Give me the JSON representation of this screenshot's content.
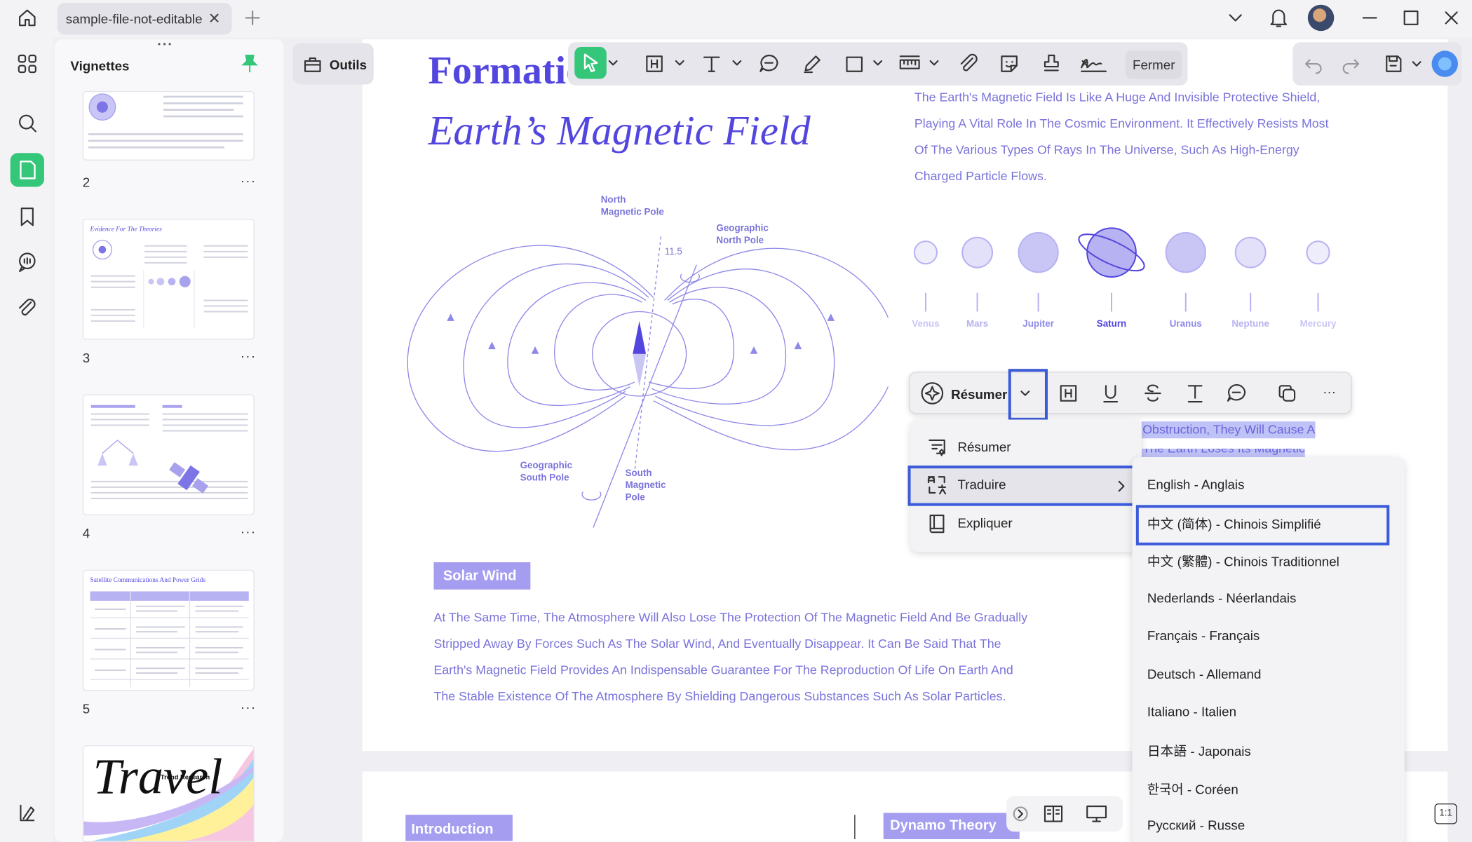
{
  "tab": {
    "title": "sample-file-not-editable",
    "close": "✕"
  },
  "sidebar": {
    "title": "Vignettes",
    "drag_dots": "• • •",
    "pages": [
      "2",
      "3",
      "4",
      "5"
    ],
    "page_more": "···"
  },
  "thumbnails": {
    "page3_title": "Evidence For The Theories",
    "page5_title": "Satellite Communications And Power Grids",
    "page6_text": "Travel",
    "page6_sub": "Trend Research"
  },
  "toolbar": {
    "outils": "Outils",
    "fermer": "Fermer"
  },
  "document": {
    "title_line1": "Formation Of The",
    "title_line2": "Earth’s Magnetic Field",
    "intro_lines": [
      "The Earth's Magnetic Field Is Like A Huge And Invisible Protective Shield,",
      "Playing A Vital Role In The Cosmic Environment. It Effectively Resists Most",
      "Of The Various Types Of Rays In The Universe, Such As High-Energy",
      "Charged Particle Flows."
    ],
    "diagram_labels": {
      "north_magnetic": [
        "North",
        "Magnetic Pole"
      ],
      "geo_north": [
        "Geographic",
        "North Pole"
      ],
      "angle": "11.5",
      "geo_south": [
        "Geographic",
        "South Pole"
      ],
      "south_magnetic": [
        "South",
        "Magnetic",
        "Pole"
      ]
    },
    "planets": [
      "Venus",
      "Mars",
      "Jupiter",
      "Saturn",
      "Uranus",
      "Neptune",
      "Mercury"
    ],
    "solar_wind": "Solar Wind",
    "body_lines": [
      "At The Same Time, The Atmosphere Will Also Lose The Protection Of The Magnetic Field And Be Gradually",
      "Stripped Away By Forces Such As The Solar Wind, And Eventually Disappear. It Can Be Said That The",
      "Earth's Magnetic Field Provides An Indispensable Guarantee For The Reproduction Of Life On Earth And",
      "The Stable Existence Of The Atmosphere By Shielding Dangerous Substances Such As Solar Particles."
    ],
    "selected_lines": [
      "Obstruction, They Will Cause A",
      "The Earth Loses Its Magnetic"
    ],
    "page2_intro": "Introduction",
    "page2_dynamo": "Dynamo Theory"
  },
  "selection_bar": {
    "resumer": "Résumer",
    "more": "···"
  },
  "ai_menu": {
    "items": [
      "Résumer",
      "Traduire",
      "Expliquer"
    ]
  },
  "languages": [
    "English - Anglais",
    "中文 (简体) - Chinois Simplifié",
    "中文 (繁體) - Chinois Traditionnel",
    "Nederlands - Néerlandais",
    "Français - Français",
    "Deutsch - Allemand",
    "Italiano - Italien",
    "日本語 - Japonais",
    "한국어 - Coréen",
    "Русский - Russe"
  ],
  "zoom_fit": "1:1",
  "colors": {
    "accent": "#5346df",
    "highlight": "#3b5bd9",
    "green": "#34c77a"
  }
}
